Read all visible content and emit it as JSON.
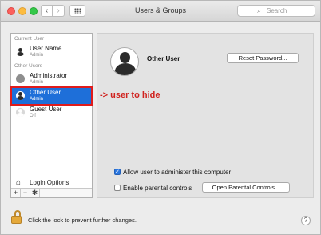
{
  "window": {
    "title": "Users & Groups"
  },
  "toolbar": {
    "back": "‹",
    "forward": "›",
    "search_placeholder": "Search",
    "search_glyph": "⌕"
  },
  "sidebar": {
    "current_user_header": "Current User",
    "current_user": {
      "name": "User Name",
      "role": "Admin"
    },
    "other_users_header": "Other Users",
    "users": [
      {
        "name": "Administrator",
        "role": "Admin"
      },
      {
        "name": "Other User",
        "role": "Admin",
        "selected": true
      },
      {
        "name": "Guest User",
        "role": "Off"
      }
    ],
    "login_options": "Login Options",
    "add": "+",
    "remove": "−",
    "gear": "✱"
  },
  "detail": {
    "user_name": "Other User",
    "reset_password": "Reset Password...",
    "annotation": "-> user to hide",
    "allow_admin_label": "Allow user to administer this computer",
    "allow_admin_checked": true,
    "parental_label": "Enable parental controls",
    "parental_checked": false,
    "open_parental": "Open Parental Controls...",
    "check_glyph": "✓"
  },
  "footer": {
    "lock_text": "Click the lock to prevent further changes.",
    "help": "?"
  },
  "colors": {
    "selection": "#1e6fd9",
    "annotation": "#d0231f",
    "highlight_border": "#e01b1b"
  }
}
